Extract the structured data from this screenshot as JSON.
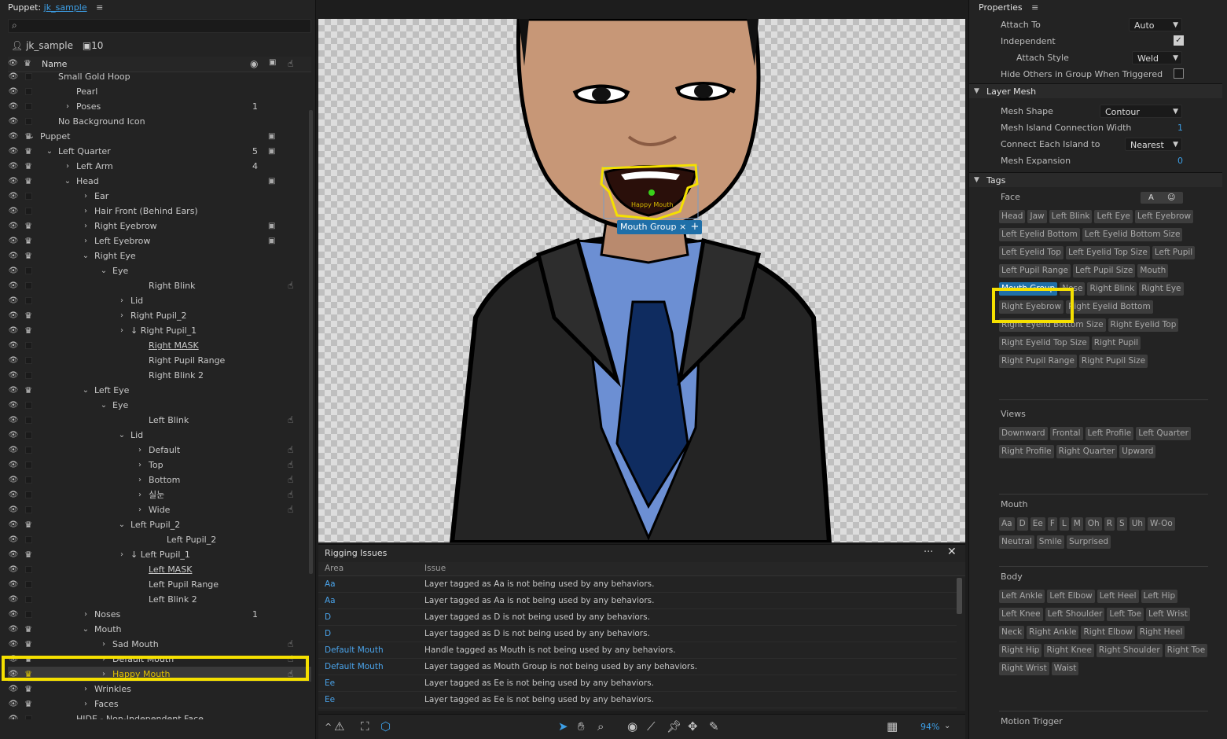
{
  "left_panel": {
    "title_prefix": "Puppet:",
    "title_link": "jk_sample",
    "puppet_name": "jk_sample",
    "puppet_count": "10",
    "col_name": "Name",
    "rows": [
      {
        "label": "Small Gold Hoop",
        "indent": 0,
        "twirl": "",
        "crown": false
      },
      {
        "label": "Pearl",
        "indent": 1,
        "twirl": "",
        "crown": false
      },
      {
        "label": "Poses",
        "indent": 1,
        "twirl": ">",
        "crown": false,
        "num": "1"
      },
      {
        "label": "No Background Icon",
        "indent": 0,
        "twirl": "",
        "crown": false
      },
      {
        "label": "Puppet",
        "indent": -1,
        "twirl": "v",
        "crown": true,
        "cam": true
      },
      {
        "label": "Left Quarter",
        "indent": 0,
        "twirl": "v",
        "crown": true,
        "num": "5",
        "cam": true
      },
      {
        "label": "Left Arm",
        "indent": 1,
        "twirl": ">",
        "crown": true,
        "num": "4"
      },
      {
        "label": "Head",
        "indent": 1,
        "twirl": "v",
        "crown": true,
        "cam": true
      },
      {
        "label": "Ear",
        "indent": 2,
        "twirl": ">",
        "crown": false
      },
      {
        "label": "Hair Front (Behind Ears)",
        "indent": 2,
        "twirl": ">",
        "crown": false
      },
      {
        "label": "Right Eyebrow",
        "indent": 2,
        "twirl": ">",
        "crown": true,
        "cam": true
      },
      {
        "label": "Left Eyebrow",
        "indent": 2,
        "twirl": ">",
        "crown": true,
        "cam": true
      },
      {
        "label": "Right Eye",
        "indent": 2,
        "twirl": "v",
        "crown": true
      },
      {
        "label": "Eye",
        "indent": 3,
        "twirl": "v",
        "crown": false
      },
      {
        "label": "Right Blink",
        "indent": 5,
        "twirl": "",
        "crown": false,
        "hnd": true
      },
      {
        "label": "Lid",
        "indent": 4,
        "twirl": ">",
        "crown": false
      },
      {
        "label": "Right Pupil_2",
        "indent": 4,
        "twirl": ">",
        "crown": true
      },
      {
        "label": "↓ Right Pupil_1",
        "indent": 4,
        "twirl": ">",
        "crown": true
      },
      {
        "label": "Right MASK",
        "indent": 5,
        "twirl": "",
        "crown": false,
        "u": true
      },
      {
        "label": "Right Pupil Range",
        "indent": 5,
        "twirl": "",
        "crown": false
      },
      {
        "label": "Right Blink 2",
        "indent": 5,
        "twirl": "",
        "crown": false
      },
      {
        "label": "Left Eye",
        "indent": 2,
        "twirl": "v",
        "crown": true
      },
      {
        "label": "Eye",
        "indent": 3,
        "twirl": "v",
        "crown": false
      },
      {
        "label": "Left Blink",
        "indent": 5,
        "twirl": "",
        "crown": false,
        "hnd": true
      },
      {
        "label": "Lid",
        "indent": 4,
        "twirl": "v",
        "crown": false
      },
      {
        "label": "Default",
        "indent": 5,
        "twirl": ">",
        "crown": false,
        "hnd": true
      },
      {
        "label": "Top",
        "indent": 5,
        "twirl": ">",
        "crown": false,
        "hnd": true
      },
      {
        "label": "Bottom",
        "indent": 5,
        "twirl": ">",
        "crown": false,
        "hnd": true
      },
      {
        "label": "실눈",
        "indent": 5,
        "twirl": ">",
        "crown": false,
        "hnd": true
      },
      {
        "label": "Wide",
        "indent": 5,
        "twirl": ">",
        "crown": false,
        "hnd": true
      },
      {
        "label": "Left Pupil_2",
        "indent": 4,
        "twirl": "v",
        "crown": true
      },
      {
        "label": "Left Pupil_2",
        "indent": 6,
        "twirl": "",
        "crown": false
      },
      {
        "label": "↓ Left Pupil_1",
        "indent": 4,
        "twirl": ">",
        "crown": true
      },
      {
        "label": "Left MASK",
        "indent": 5,
        "twirl": "",
        "crown": false,
        "u": true
      },
      {
        "label": "Left Pupil Range",
        "indent": 5,
        "twirl": "",
        "crown": false
      },
      {
        "label": "Left Blink 2",
        "indent": 5,
        "twirl": "",
        "crown": false
      },
      {
        "label": "Noses",
        "indent": 2,
        "twirl": ">",
        "crown": false,
        "num": "1"
      },
      {
        "label": "Mouth",
        "indent": 2,
        "twirl": "v",
        "crown": true
      },
      {
        "label": "Sad Mouth",
        "indent": 3,
        "twirl": ">",
        "crown": true,
        "hnd": true
      },
      {
        "label": "Default Mouth",
        "indent": 3,
        "twirl": ">",
        "crown": true,
        "hnd": true
      },
      {
        "label": "Happy Mouth",
        "indent": 3,
        "twirl": ">",
        "crown": true,
        "hnd": true,
        "sel": true
      },
      {
        "label": "Wrinkles",
        "indent": 2,
        "twirl": ">",
        "crown": true
      },
      {
        "label": "Faces",
        "indent": 2,
        "twirl": ">",
        "crown": true
      },
      {
        "label": "HIDE - Non-Independent Face",
        "indent": 1,
        "twirl": "",
        "crown": false
      }
    ]
  },
  "canvas": {
    "mouth_tag": "Mouth Group",
    "mouth_tag_close": "×",
    "mouth_label": "Happy Mouth",
    "add": "+"
  },
  "rigging": {
    "title": "Rigging Issues",
    "more": "···",
    "close": "✕",
    "col_area": "Area",
    "col_issue": "Issue",
    "issues": [
      {
        "area": "Aa",
        "issue": "Layer tagged as Aa is not being used by any behaviors."
      },
      {
        "area": "Aa",
        "issue": "Layer tagged as Aa is not being used by any behaviors."
      },
      {
        "area": "D",
        "issue": "Layer tagged as D is not being used by any behaviors."
      },
      {
        "area": "D",
        "issue": "Layer tagged as D is not being used by any behaviors."
      },
      {
        "area": "Default Mouth",
        "issue": "Handle tagged as Mouth is not being used by any behaviors."
      },
      {
        "area": "Default Mouth",
        "issue": "Layer tagged as Mouth Group is not being used by any behaviors."
      },
      {
        "area": "Ee",
        "issue": "Layer tagged as Ee is not being used by any behaviors."
      },
      {
        "area": "Ee",
        "issue": "Layer tagged as Ee is not being used by any behaviors."
      }
    ]
  },
  "toolbar": {
    "zoom": "94%"
  },
  "properties": {
    "title": "Properties",
    "attach_to_label": "Attach To",
    "attach_to_value": "Auto",
    "independent_label": "Independent",
    "attach_style_label": "Attach Style",
    "attach_style_value": "Weld",
    "hide_others_label": "Hide Others in Group When Triggered",
    "layer_mesh": "Layer Mesh",
    "mesh_shape_label": "Mesh Shape",
    "mesh_shape_value": "Contour",
    "mesh_island_label": "Mesh Island Connection Width",
    "mesh_island_value": "1",
    "connect_label": "Connect Each Island to",
    "connect_value": "Nearest",
    "mesh_expansion_label": "Mesh Expansion",
    "mesh_expansion_value": "0",
    "tags_section": "Tags",
    "face_toggle_a": "A",
    "groups": {
      "face": {
        "name": "Face",
        "tags": [
          "Head",
          "Jaw",
          "Left Blink",
          "Left Eye",
          "Left Eyebrow",
          "Left Eyelid Bottom",
          "Left Eyelid Bottom Size",
          "Left Eyelid Top",
          "Left Eyelid Top Size",
          "Left Pupil",
          "Left Pupil Range",
          "Left Pupil Size",
          "Mouth",
          "Mouth Group",
          "Nose",
          "Right Blink",
          "Right Eye",
          "Right Eyebrow",
          "Right Eyelid Bottom",
          "Right Eyelid Bottom Size",
          "Right Eyelid Top",
          "Right Eyelid Top Size",
          "Right Pupil",
          "Right Pupil Range",
          "Right Pupil Size"
        ]
      },
      "views": {
        "name": "Views",
        "tags": [
          "Downward",
          "Frontal",
          "Left Profile",
          "Left Quarter",
          "Right Profile",
          "Right Quarter",
          "Upward"
        ]
      },
      "mouth": {
        "name": "Mouth",
        "tags": [
          "Aa",
          "D",
          "Ee",
          "F",
          "L",
          "M",
          "Oh",
          "R",
          "S",
          "Uh",
          "W-Oo",
          "Neutral",
          "Smile",
          "Surprised"
        ]
      },
      "body": {
        "name": "Body",
        "tags": [
          "Left Ankle",
          "Left Elbow",
          "Left Heel",
          "Left Hip",
          "Left Knee",
          "Left Shoulder",
          "Left Toe",
          "Left Wrist",
          "Neck",
          "Right Ankle",
          "Right Elbow",
          "Right Heel",
          "Right Hip",
          "Right Knee",
          "Right Shoulder",
          "Right Toe",
          "Right Wrist",
          "Waist"
        ]
      },
      "motion": {
        "name": "Motion Trigger"
      }
    },
    "active_tag": "Mouth Group"
  }
}
